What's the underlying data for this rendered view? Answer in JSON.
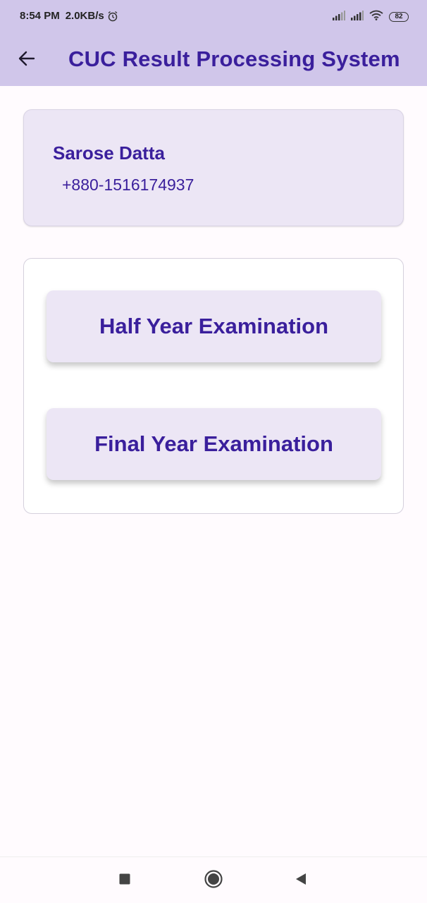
{
  "status_bar": {
    "time": "8:54 PM",
    "net_speed": "2.0KB/s",
    "battery": "82",
    "icons": [
      "alarm-icon",
      "signal-icon",
      "signal-icon",
      "wifi-icon",
      "battery-icon"
    ]
  },
  "app_bar": {
    "title": "CUC Result Processing System",
    "back_icon": "arrow-left-icon"
  },
  "profile": {
    "name": "Sarose Datta",
    "phone": "+880-1516174937"
  },
  "exams": {
    "half_label": "Half Year Examination",
    "final_label": "Final Year Examination"
  },
  "nav_bar": {
    "icons": [
      "square-icon",
      "circle-icon",
      "triangle-back-icon"
    ]
  },
  "colors": {
    "app_bar_bg": "#d0c6ea",
    "primary_text": "#3a1f9c",
    "card_bg": "#ece6f5",
    "page_bg": "#fffbfe"
  }
}
